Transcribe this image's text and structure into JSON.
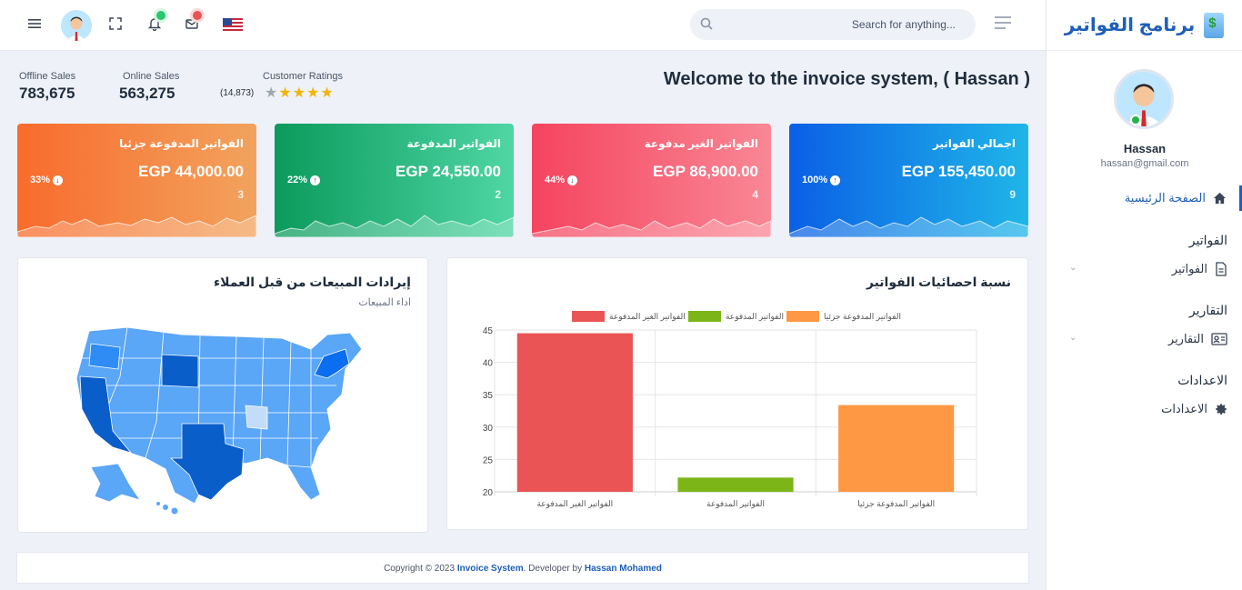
{
  "brand": {
    "title": "برنامج الفواتير"
  },
  "user": {
    "name": "Hassan",
    "email": "hassan@gmail.com"
  },
  "sidebar": {
    "home_label": "الصفحة الرئيسية",
    "sections": [
      {
        "title": "الفواتير",
        "item": "الفواتير",
        "icon": "document-icon"
      },
      {
        "title": "التقارير",
        "item": "التقارير",
        "icon": "id-card-icon"
      },
      {
        "title": "الاعدادات",
        "item": "الاعدادات",
        "icon": "gear-icon"
      }
    ]
  },
  "topbar": {
    "search_placeholder": "Search for anything...",
    "language": "en-US"
  },
  "stats": {
    "offline": {
      "label": "Offline Sales",
      "value": "783,675"
    },
    "online": {
      "label": "Online Sales",
      "value": "563,275"
    },
    "ratings": {
      "label": "Customer Ratings",
      "count": "(14,873)",
      "stars": 4
    }
  },
  "welcome": "Welcome to the invoice system, ( Hassan )",
  "cards": [
    {
      "title": "الفواتير المدفوعة جزئيا",
      "amount": "EGP 44,000.00",
      "percent": "33%",
      "direction": "down",
      "count": "3"
    },
    {
      "title": "الفواتير المدفوعة",
      "amount": "EGP 24,550.00",
      "percent": "22%",
      "direction": "up",
      "count": "2"
    },
    {
      "title": "الفواتير الغير مدفوعة",
      "amount": "EGP 86,900.00",
      "percent": "44%",
      "direction": "down",
      "count": "4"
    },
    {
      "title": "اجمالي الفواتير",
      "amount": "EGP 155,450.00",
      "percent": "100%",
      "direction": "up",
      "count": "9"
    }
  ],
  "map_panel": {
    "title": "إيرادات المبيعات من قبل العملاء",
    "subtitle": "اداء المبيعات"
  },
  "chart_panel": {
    "title": "نسبة احصائيات الفواتير"
  },
  "chart_data": {
    "type": "bar",
    "categories": [
      "الفواتير الغير المدفوعة",
      "الفواتير المدفوعة",
      "الفواتير المدفوعة جزئيا"
    ],
    "series": [
      {
        "name": "الفواتير الغير المدفوعة",
        "color": "#ea5455",
        "values": [
          44.5,
          null,
          null
        ]
      },
      {
        "name": "الفواتير المدفوعة",
        "color": "#7cb518",
        "values": [
          null,
          22.2,
          null
        ]
      },
      {
        "name": "الفواتير المدفوعة جزئيا",
        "color": "#ff9845",
        "values": [
          null,
          null,
          33.4
        ]
      }
    ],
    "yticks": [
      "20",
      "25",
      "30",
      "35",
      "40",
      "45"
    ],
    "ylim": [
      20,
      45
    ],
    "legend": "top",
    "grid": true
  },
  "footer": {
    "prefix": "Copyright © 2023",
    "system": "Invoice System",
    "middle": ". Developer by",
    "developer": "Hassan Mohamed"
  }
}
